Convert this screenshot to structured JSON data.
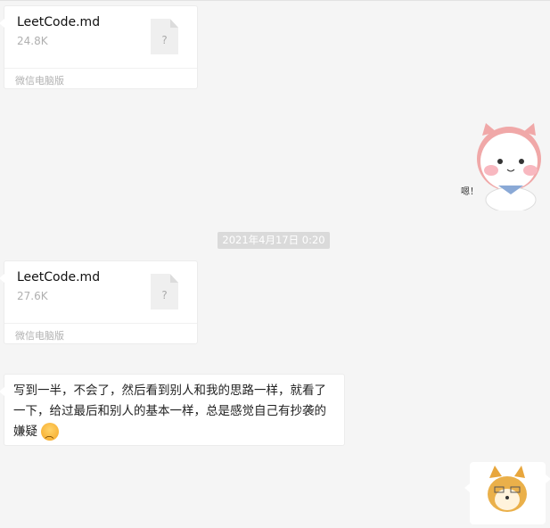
{
  "messages": [
    {
      "type": "file",
      "name": "LeetCode.md",
      "size": "24.8K",
      "source": "微信电脑版",
      "icon": "unknown-file-icon",
      "icon_glyph": "?"
    },
    {
      "type": "sticker",
      "sticker": "white-cat-sticker",
      "caption": "嗯！"
    },
    {
      "type": "timestamp",
      "text": "2021年4月17日 0:20"
    },
    {
      "type": "file",
      "name": "LeetCode.md",
      "size": "27.6K",
      "source": "微信电脑版",
      "icon": "unknown-file-icon",
      "icon_glyph": "?"
    },
    {
      "type": "text",
      "text": "写到一半，不会了，然后看到别人和我的思路一样，就看了一下，给过最后和别人的基本一样，总是感觉自己有抄袭的嫌疑",
      "emoji": "sad-face-emoji"
    },
    {
      "type": "sticker",
      "sticker": "shiba-dog-sticker"
    }
  ],
  "colors": {
    "background": "#f5f5f5",
    "bubble": "#ffffff",
    "timestamp_bg": "#dadada"
  }
}
